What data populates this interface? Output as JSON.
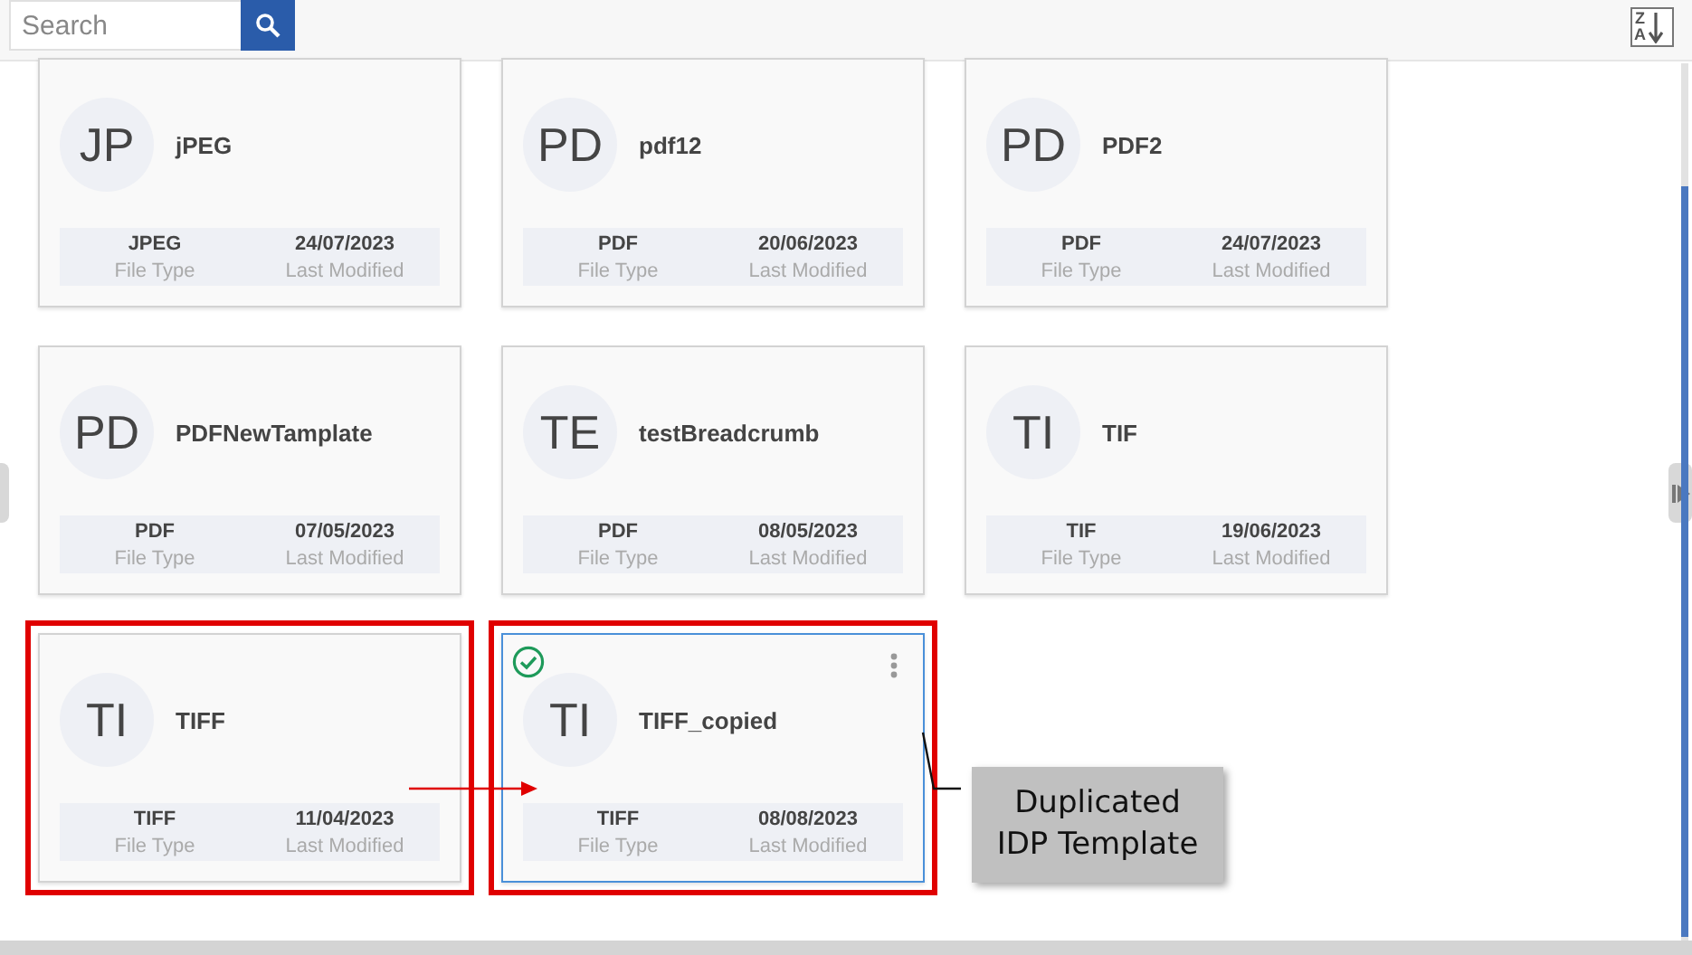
{
  "toolbar": {
    "search": {
      "placeholder": "Search"
    },
    "sort_button": {
      "top_letter": "Z",
      "bottom_letter": "A"
    }
  },
  "templates": [
    {
      "initials": "JP",
      "name": "jPEG",
      "file_type": "JPEG",
      "file_type_label": "File Type",
      "modified": "24/07/2023",
      "modified_label": "Last Modified",
      "selected": false,
      "highlighted": false
    },
    {
      "initials": "PD",
      "name": "pdf12",
      "file_type": "PDF",
      "file_type_label": "File Type",
      "modified": "20/06/2023",
      "modified_label": "Last Modified",
      "selected": false,
      "highlighted": false
    },
    {
      "initials": "PD",
      "name": "PDF2",
      "file_type": "PDF",
      "file_type_label": "File Type",
      "modified": "24/07/2023",
      "modified_label": "Last Modified",
      "selected": false,
      "highlighted": false
    },
    {
      "initials": "PD",
      "name": "PDFNewTamplate",
      "file_type": "PDF",
      "file_type_label": "File Type",
      "modified": "07/05/2023",
      "modified_label": "Last Modified",
      "selected": false,
      "highlighted": false
    },
    {
      "initials": "TE",
      "name": "testBreadcrumb",
      "file_type": "PDF",
      "file_type_label": "File Type",
      "modified": "08/05/2023",
      "modified_label": "Last Modified",
      "selected": false,
      "highlighted": false
    },
    {
      "initials": "TI",
      "name": "TIF",
      "file_type": "TIF",
      "file_type_label": "File Type",
      "modified": "19/06/2023",
      "modified_label": "Last Modified",
      "selected": false,
      "highlighted": false
    },
    {
      "initials": "TI",
      "name": "TIFF",
      "file_type": "TIFF",
      "file_type_label": "File Type",
      "modified": "11/04/2023",
      "modified_label": "Last Modified",
      "selected": false,
      "highlighted": true
    },
    {
      "initials": "TI",
      "name": "TIFF_copied",
      "file_type": "TIFF",
      "file_type_label": "File Type",
      "modified": "08/08/2023",
      "modified_label": "Last Modified",
      "selected": true,
      "highlighted": true
    }
  ],
  "callout": {
    "text": "Duplicated IDP Template"
  }
}
